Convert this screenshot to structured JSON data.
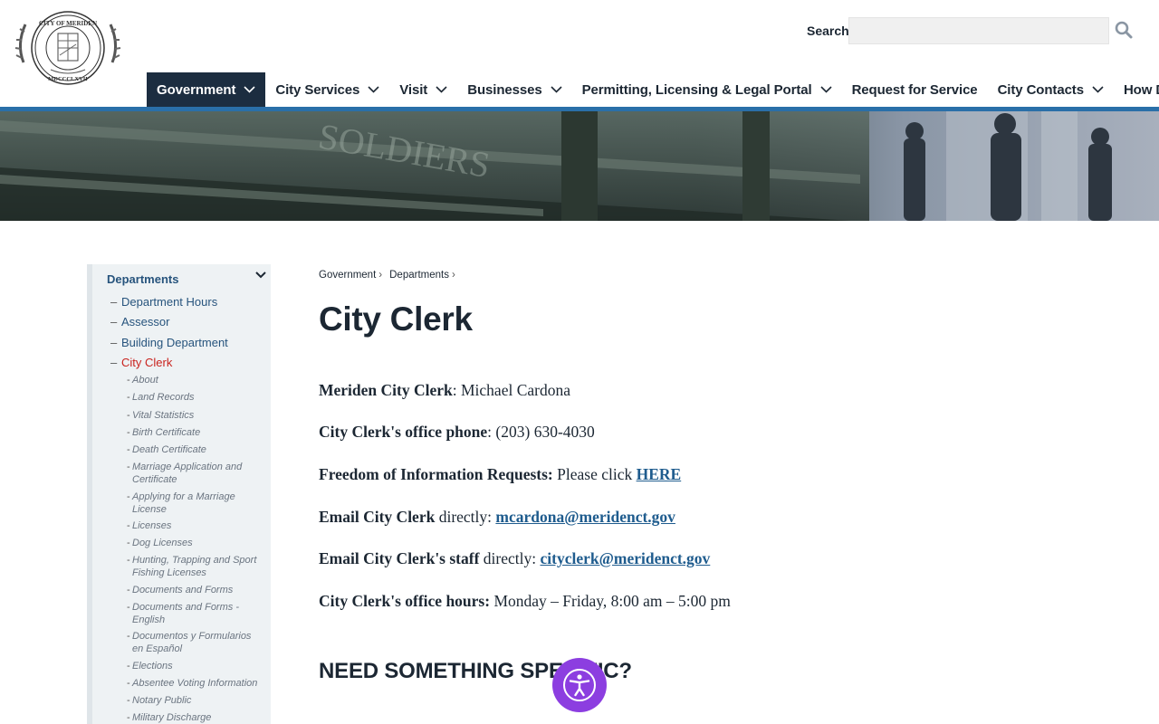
{
  "header": {
    "logo_alt": "City of Meriden seal",
    "logo_text_top": "CITY OF MERIDEN",
    "logo_text_bottom": "MDCCCLXVII",
    "search_label": "Search",
    "search_placeholder": "",
    "search_icon": "search-icon"
  },
  "nav": {
    "items": [
      {
        "label": "Government",
        "dropdown": true,
        "active": true
      },
      {
        "label": "City Services",
        "dropdown": true
      },
      {
        "label": "Visit",
        "dropdown": true
      },
      {
        "label": "Businesses",
        "dropdown": true
      },
      {
        "label": "Permitting, Licensing & Legal Portal",
        "dropdown": true
      },
      {
        "label": "Request for Service",
        "dropdown": false
      },
      {
        "label": "City Contacts",
        "dropdown": true
      },
      {
        "label": "How Do I?",
        "dropdown": true
      }
    ]
  },
  "colors": {
    "nav_active_bg": "#1c2d40",
    "accent_blue": "#2a6fa8",
    "current_item": "#c9241f",
    "link": "#1f5c8e",
    "a11y_button": "#8c3ee0"
  },
  "sidebar": {
    "heading": "Departments",
    "toggle_icon": "chevron-down-icon",
    "level1": [
      {
        "label": "Department Hours"
      },
      {
        "label": "Assessor"
      },
      {
        "label": "Building Department"
      },
      {
        "label": "City Clerk",
        "current": true
      }
    ],
    "level2": [
      {
        "label": "About"
      },
      {
        "label": "Land Records"
      },
      {
        "label": "Vital Statistics"
      },
      {
        "label": "Birth Certificate"
      },
      {
        "label": "Death Certificate"
      },
      {
        "label": "Marriage Application and Certificate"
      },
      {
        "label": "Applying for a Marriage License"
      },
      {
        "label": "Licenses"
      },
      {
        "label": "Dog Licenses"
      },
      {
        "label": "Hunting, Trapping and Sport Fishing Licenses"
      },
      {
        "label": "Documents and Forms"
      },
      {
        "label": "Documents and Forms - English"
      },
      {
        "label": "Documentos y Formularios en Español"
      },
      {
        "label": "Elections"
      },
      {
        "label": "Absentee Voting Information"
      },
      {
        "label": "Notary Public"
      },
      {
        "label": "Military Discharge"
      }
    ]
  },
  "breadcrumb": [
    {
      "label": "Government"
    },
    {
      "label": "Departments"
    }
  ],
  "main": {
    "title": "City Clerk",
    "rows": [
      {
        "bold": "Meriden City Clerk",
        "text": ": Michael Cardona",
        "link": ""
      },
      {
        "bold": "City Clerk's office phone",
        "text": ": (203) 630-4030",
        "link": ""
      },
      {
        "bold": "Freedom of Information Requests:",
        "text": " Please click ",
        "link": "HERE"
      },
      {
        "bold": "Email City Clerk",
        "text": " directly: ",
        "link": "mcardona@meridenct.gov"
      },
      {
        "bold": "Email City Clerk's staff",
        "text": " directly: ",
        "link": "cityclerk@meridenct.gov"
      },
      {
        "bold": "City Clerk's office hours:",
        "text": " Monday – Friday, 8:00 am – 5:00 pm",
        "link": ""
      }
    ],
    "section_title": "NEED SOMETHING SPECIFIC?"
  },
  "accessibility": {
    "icon": "accessibility-icon"
  }
}
